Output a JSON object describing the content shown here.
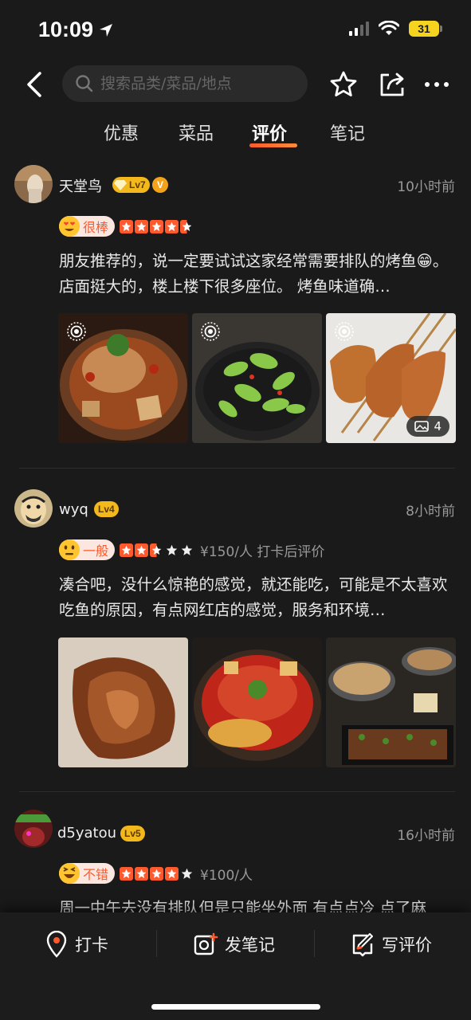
{
  "status_bar": {
    "time": "10:09",
    "battery": "31"
  },
  "header": {
    "search_placeholder": "搜索品类/菜品/地点"
  },
  "tabs": [
    {
      "label": "优惠"
    },
    {
      "label": "菜品"
    },
    {
      "label": "评价",
      "active": true
    },
    {
      "label": "笔记"
    }
  ],
  "reviews": [
    {
      "username": "天堂鸟",
      "level": "Lv7",
      "verified_badge": "V",
      "time_ago": "10小时前",
      "mood": "很棒",
      "stars": 5,
      "meta": "",
      "text": "朋友推荐的，说一定要试试这家经常需要排队的烤鱼😁。 店面挺大的，楼上楼下很多座位。 烤鱼味道确…",
      "photo_count": "4"
    },
    {
      "username": "wyq",
      "level": "Lv4",
      "time_ago": "8小时前",
      "mood": "一般",
      "stars": 2.5,
      "meta": "¥150/人 打卡后评价",
      "text": "凑合吧，没什么惊艳的感觉，就还能吃，可能是不太喜欢吃鱼的原因，有点网红店的感觉，服务和环境…"
    },
    {
      "username": "d5yatou",
      "level": "Lv5",
      "time_ago": "16小时前",
      "mood": "不错",
      "stars": 4,
      "meta": "¥100/人",
      "text": "周一中午去没有排队但是只能坐外面 有点点冷 点了麻"
    }
  ],
  "bottom_bar": [
    {
      "label": "打卡",
      "icon": "location-pin-icon"
    },
    {
      "label": "发笔记",
      "icon": "camera-note-icon"
    },
    {
      "label": "写评价",
      "icon": "write-review-icon"
    }
  ],
  "colors": {
    "accent": "#ff5a2d",
    "level_badge": "#f3b81c",
    "background": "#1a1a1a"
  }
}
